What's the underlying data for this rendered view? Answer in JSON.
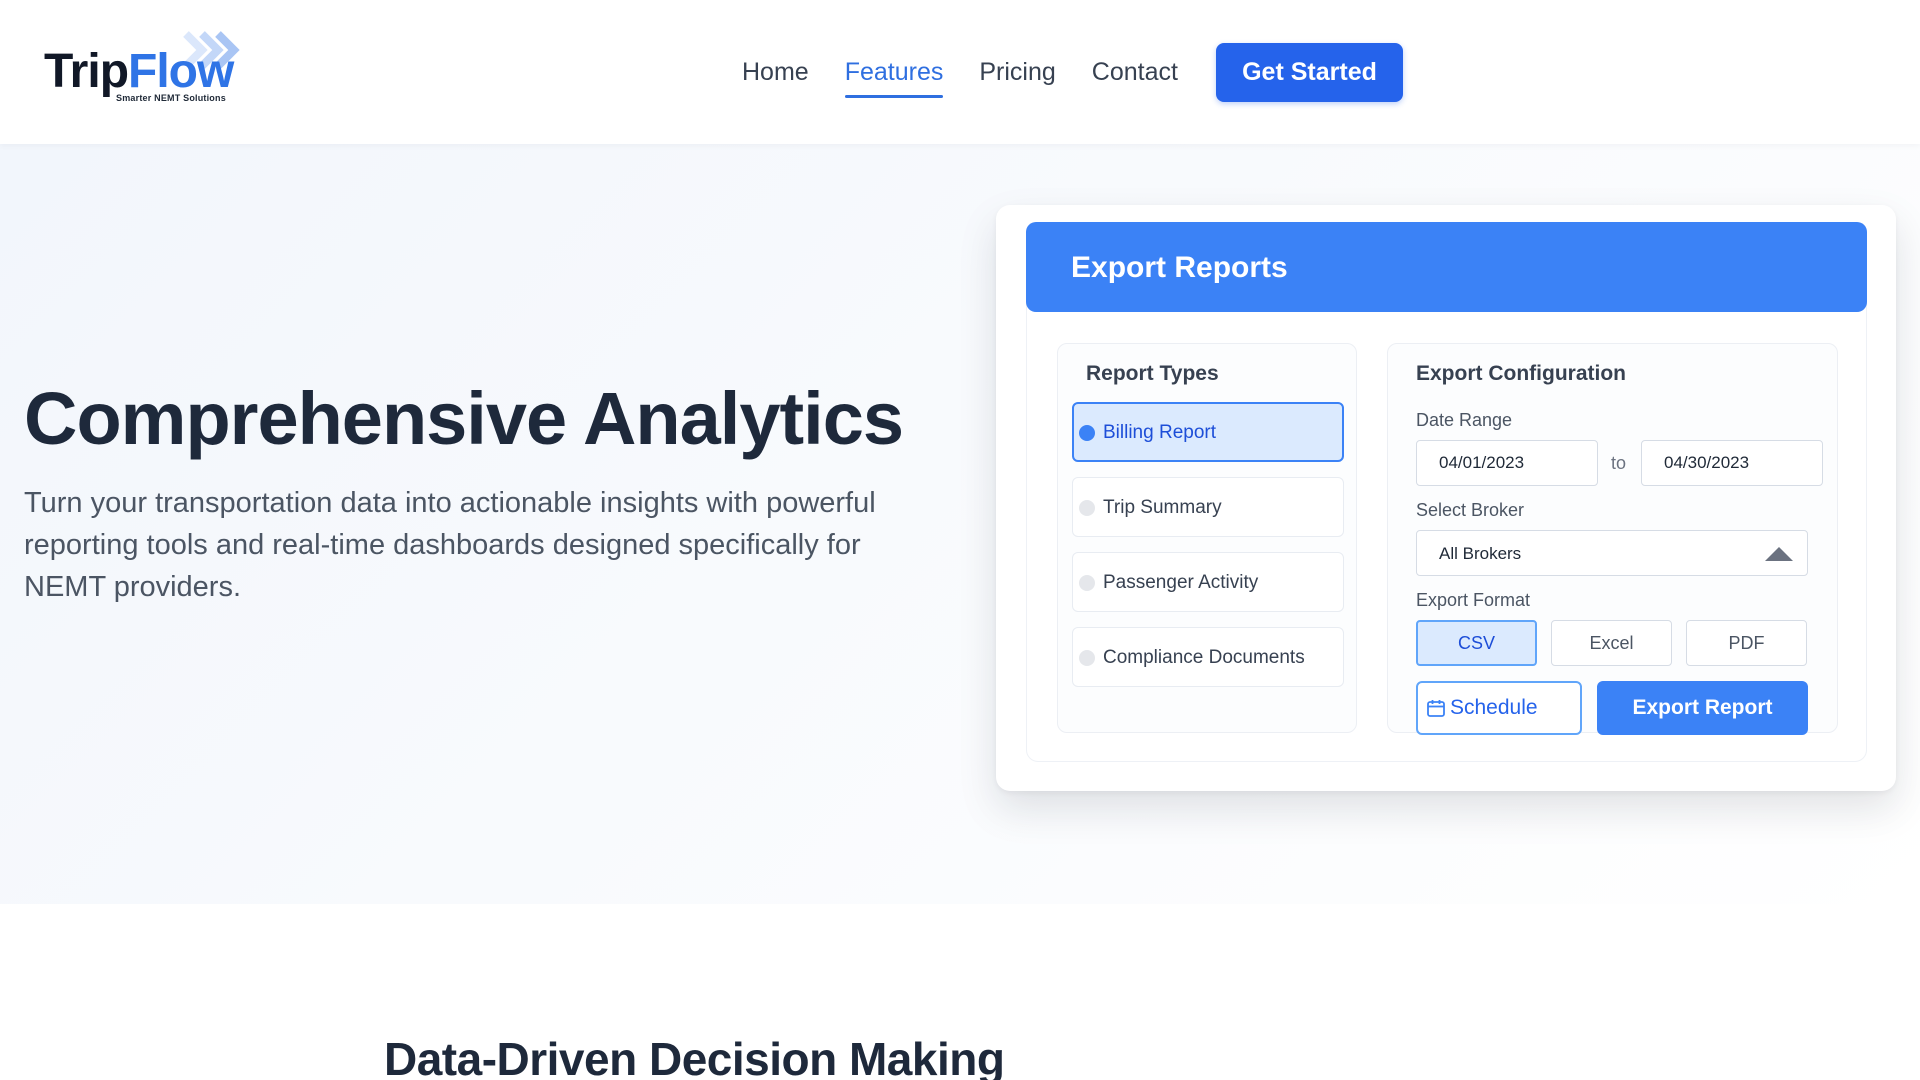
{
  "brand": {
    "name_part1": "Trip",
    "name_part2": "Flow",
    "tagline": "Smarter NEMT Solutions",
    "primary_color": "#2563eb",
    "accent_color": "#3b82f6"
  },
  "nav": {
    "items": [
      {
        "label": "Home",
        "active": false
      },
      {
        "label": "Features",
        "active": true
      },
      {
        "label": "Pricing",
        "active": false
      },
      {
        "label": "Contact",
        "active": false
      }
    ],
    "cta_label": "Get Started"
  },
  "hero": {
    "title": "Comprehensive Analytics",
    "subtitle": "Turn your transportation data into actionable insights with powerful reporting tools and real-time dashboards designed specifically for NEMT providers."
  },
  "export_card": {
    "title": "Export Reports",
    "report_types": {
      "heading": "Report Types",
      "items": [
        {
          "label": "Billing Report",
          "selected": true
        },
        {
          "label": "Trip Summary",
          "selected": false
        },
        {
          "label": "Passenger Activity",
          "selected": false
        },
        {
          "label": "Compliance Documents",
          "selected": false
        }
      ]
    },
    "config": {
      "heading": "Export Configuration",
      "date_range_label": "Date Range",
      "date_from": "04/01/2023",
      "date_separator": "to",
      "date_to": "04/30/2023",
      "broker_label": "Select Broker",
      "broker_value": "All Brokers",
      "format_label": "Export Format",
      "formats": [
        {
          "label": "CSV",
          "selected": true
        },
        {
          "label": "Excel",
          "selected": false
        },
        {
          "label": "PDF",
          "selected": false
        }
      ],
      "schedule_label": "Schedule",
      "export_label": "Export Report"
    }
  },
  "next_section": {
    "title": "Data-Driven Decision Making"
  }
}
